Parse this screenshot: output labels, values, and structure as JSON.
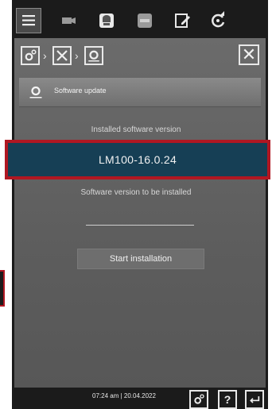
{
  "header": {
    "title": "Software update"
  },
  "installed": {
    "label": "Installed software version",
    "value": "LM100-16.0.24"
  },
  "to_install": {
    "label": "Software version to be installed",
    "value": ""
  },
  "buttons": {
    "start": "Start installation"
  },
  "footer": {
    "datetime": "07:24 am | 20.04.2022",
    "help": "?"
  },
  "colors": {
    "highlight": "#b01722",
    "version_bg": "#163f55"
  }
}
